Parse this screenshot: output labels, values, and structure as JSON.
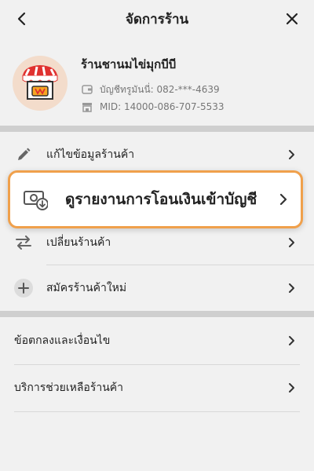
{
  "header": {
    "title": "จัดการร้าน",
    "back_icon": "chevron-left-icon",
    "close_icon": "close-icon"
  },
  "shop": {
    "name": "ร้านชานมไข่มุกบีบี",
    "account_label": "บัญชีทรูมันนี่: 082-***-4639",
    "mid_label": "MID: 14000-086-707-5533",
    "avatar_icon": "storefront-icon"
  },
  "menu": {
    "edit_shop": "แก้ไขข้อมูลร้านค้า",
    "transfer_report": "ดูรายงานการโอนเงินเข้าบัญชี",
    "switch_shop": "เปลี่ยนร้านค้า",
    "register_shop": "สมัครร้านค้าใหม่"
  },
  "links": {
    "terms": "ข้อตกลงและเงื่อนไข",
    "support": "บริการช่วยเหลือร้านค้า"
  },
  "colors": {
    "highlight_border": "#f0a04b",
    "divider": "#cfcfcf",
    "background": "#f1f1f1",
    "awning_red": "#e0312f"
  }
}
